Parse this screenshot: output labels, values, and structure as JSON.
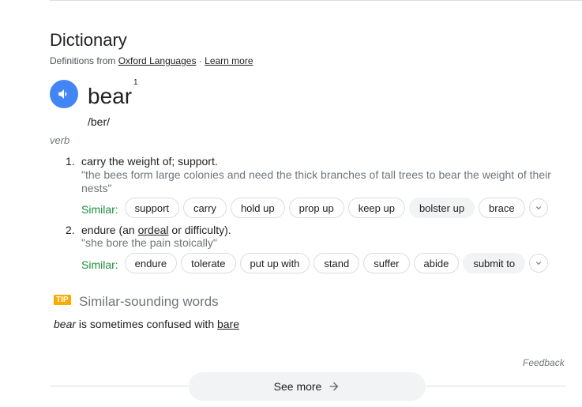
{
  "header": {
    "title": "Dictionary",
    "source_prefix": "Definitions from",
    "source_link": "Oxford Languages",
    "separator": "·",
    "learn_more": "Learn more"
  },
  "entry": {
    "word": "bear",
    "superscript": "1",
    "phonetic": "/ber/",
    "part_of_speech": "verb"
  },
  "definitions": [
    {
      "number": "1.",
      "text": "carry the weight of; support.",
      "example": "\"the bees form large colonies and need the thick branches of tall trees to bear the weight of their nests\"",
      "similar_label": "Similar:",
      "similar": [
        "support",
        "carry",
        "hold up",
        "prop up",
        "keep up",
        "bolster up",
        "brace"
      ]
    },
    {
      "number": "2.",
      "text_before": "endure (an",
      "text_link": "ordeal",
      "text_after": "or difficulty).",
      "example": "\"she bore the pain stoically\"",
      "similar_label": "Similar:",
      "similar": [
        "endure",
        "tolerate",
        "put up with",
        "stand",
        "suffer",
        "abide",
        "submit to"
      ]
    }
  ],
  "tip": {
    "badge": "TIP",
    "title": "Similar-sounding words",
    "word": "bear",
    "middle": "is sometimes confused with",
    "confused_word": "bare"
  },
  "footer": {
    "feedback": "Feedback",
    "see_more": "See more"
  },
  "colors": {
    "speaker_bg": "#4285f4",
    "similar_green": "#1e8e3e",
    "tip_badge": "#f9ab00"
  },
  "icons": {
    "speaker": "speaker-icon",
    "chevron": "chevron-down-icon",
    "arrow": "arrow-right-icon"
  }
}
